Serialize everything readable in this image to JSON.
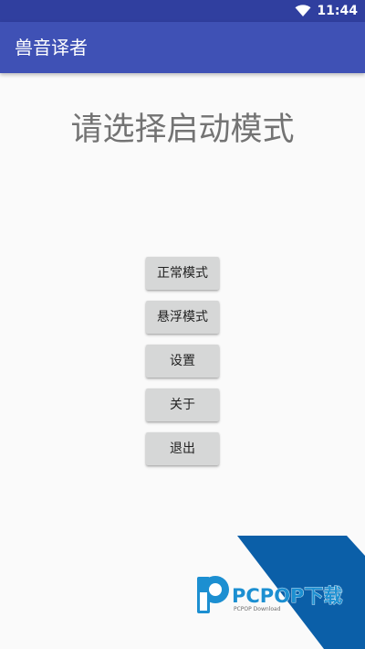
{
  "status_bar": {
    "time": "11:44",
    "icons": [
      "wifi-icon"
    ],
    "background": "#303f9f"
  },
  "app_bar": {
    "title": "兽音译者",
    "background": "#3f51b5"
  },
  "main": {
    "heading": "请选择启动模式",
    "buttons": [
      {
        "label": "正常模式"
      },
      {
        "label": "悬浮模式"
      },
      {
        "label": "设置"
      },
      {
        "label": "关于"
      },
      {
        "label": "退出"
      }
    ]
  },
  "watermark": {
    "brand": "PCPOP下载",
    "sub": "PCPOP Download",
    "accent": "#0b5fa8"
  }
}
